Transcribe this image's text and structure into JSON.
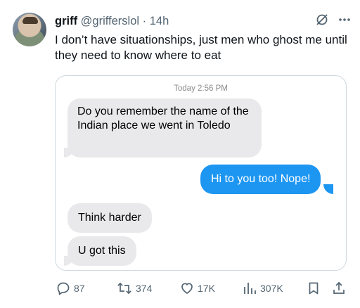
{
  "tweet": {
    "author_name": "griff",
    "handle": "@grifferslol",
    "separator": "·",
    "time": "14h",
    "text": "I don’t have situationships, just men who ghost me until they need to know where to eat"
  },
  "chat_image": {
    "timestamp_day": "Today",
    "timestamp_time": "2:56 PM",
    "messages": [
      {
        "direction": "incoming",
        "text": "Do you remember the name of the Indian place we went in Toledo"
      },
      {
        "direction": "outgoing",
        "text": "Hi to you too! Nope!"
      },
      {
        "direction": "incoming",
        "text": "Think harder"
      },
      {
        "direction": "incoming",
        "text": "U got this"
      }
    ],
    "colors": {
      "incoming": "#e9e9eb",
      "outgoing": "#1d96f2"
    }
  },
  "actions": {
    "replies": "87",
    "reposts": "374",
    "likes": "17K",
    "views": "307K"
  },
  "icons": [
    "grok-icon",
    "more-icon",
    "reply-icon",
    "repost-icon",
    "like-icon",
    "views-icon",
    "bookmark-icon",
    "share-icon"
  ]
}
